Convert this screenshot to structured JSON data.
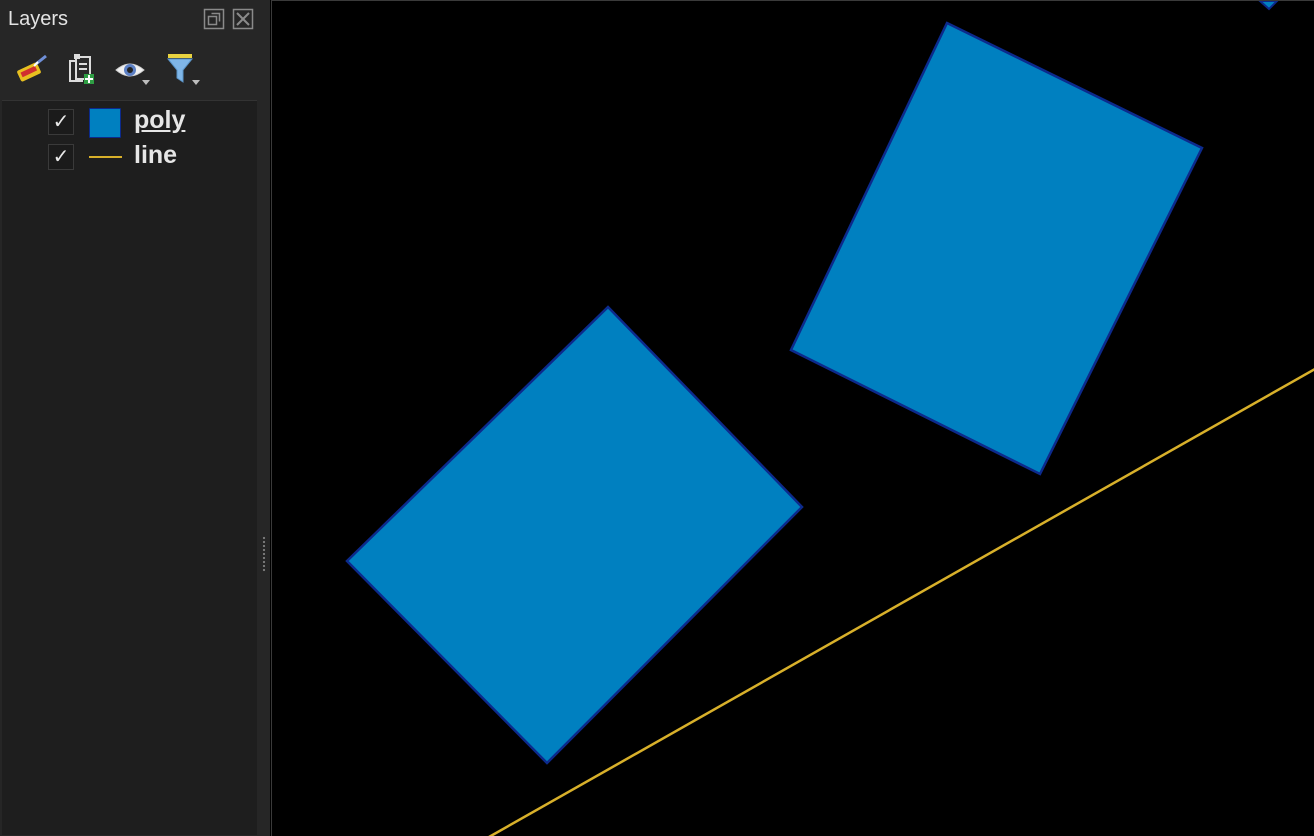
{
  "colors": {
    "poly_fill": "#0080c0",
    "poly_stroke": "#0c2a8c",
    "line_stroke": "#d8b02a",
    "panel_bg": "#262626",
    "canvas_bg": "#000000"
  },
  "layers_panel": {
    "title": "Layers",
    "header_buttons": [
      {
        "icon": "float-panel-icon"
      },
      {
        "icon": "close-panel-icon"
      }
    ],
    "toolbar": [
      {
        "icon": "style-manager-icon"
      },
      {
        "icon": "add-group-icon"
      },
      {
        "icon": "visibility-eye-icon"
      },
      {
        "icon": "filter-legend-icon"
      }
    ],
    "layers": [
      {
        "name": "poly",
        "checked": true,
        "check_glyph": "✓",
        "symbol": "fill",
        "active": true
      },
      {
        "name": "line",
        "checked": true,
        "check_glyph": "✓",
        "symbol": "line",
        "active": false
      }
    ]
  },
  "map_canvas": {
    "features": [
      {
        "layer": "poly",
        "type": "polygon"
      },
      {
        "layer": "poly",
        "type": "polygon"
      },
      {
        "layer": "poly",
        "type": "polygon"
      },
      {
        "layer": "line",
        "type": "linestring"
      }
    ]
  }
}
